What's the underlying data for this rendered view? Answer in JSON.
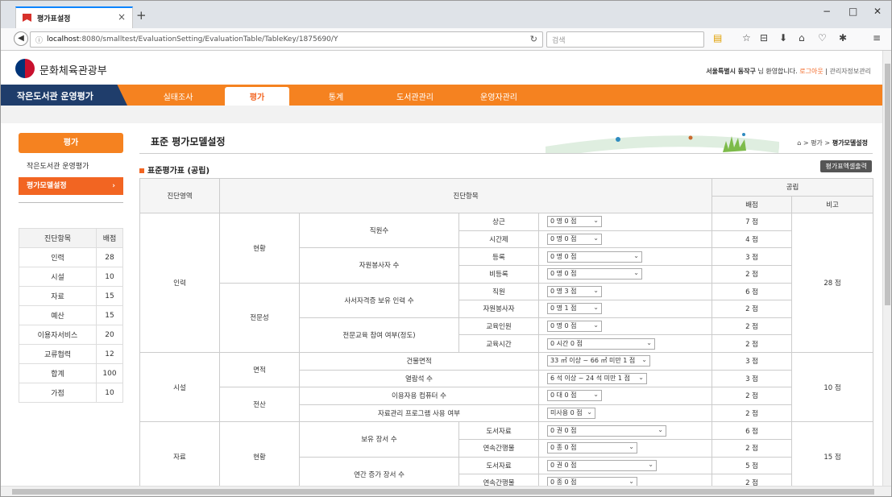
{
  "browser": {
    "tab_title": "평가표설정",
    "url_host": "localhost",
    "url_path": ":8080/smalltest/EvaluationSetting/EvaluationTable/TableKey/1875690/Y",
    "search_placeholder": "검색",
    "new_tab": "+",
    "close_tab": "×",
    "min": "−",
    "max": "□",
    "close": "✕"
  },
  "header": {
    "logo_text": "문화체육관광부",
    "user": "서울특별시 동작구",
    "welcome": " 님 환영합니다.",
    "logout": "로그아웃",
    "sep": " | ",
    "admin": "관리자정보관리"
  },
  "menubar": {
    "site_name": "작은도서관 운영평가",
    "items": [
      "실태조사",
      "평가",
      "통계",
      "도서관관리",
      "운영자관리"
    ],
    "active_index": 1
  },
  "sidebar": {
    "heading": "평가",
    "items": [
      "작은도서관 운영평가",
      "평가모델설정"
    ],
    "chevron": "›",
    "score_table": {
      "headers": [
        "진단항목",
        "배점"
      ],
      "rows": [
        [
          "인력",
          "28"
        ],
        [
          "시설",
          "10"
        ],
        [
          "자료",
          "15"
        ],
        [
          "예산",
          "15"
        ],
        [
          "이용자서비스",
          "20"
        ],
        [
          "교류협력",
          "12"
        ],
        [
          "합계",
          "100"
        ],
        [
          "가점",
          "10"
        ]
      ]
    }
  },
  "content": {
    "title": "표준 평가모델설정",
    "breadcrumb_home": "⌂",
    "breadcrumb_1": "> 평가 >",
    "breadcrumb_2": " 평가모델설정",
    "subtitle": "표준평가표 (공립)",
    "print_button": "평가표엑셀출력"
  },
  "table": {
    "h_area": "진단영역",
    "h_item": "진단항목",
    "h_public": "공립",
    "h_score": "배점",
    "h_note": "비고",
    "areas": [
      "인력",
      "시설",
      "자료"
    ],
    "groups": [
      "현황",
      "전문성",
      "면적",
      "전산",
      "현황"
    ],
    "criteria": [
      "직원수",
      "자원봉사자 수",
      "사서자격증 보유 인력 수",
      "전문교육 참여 여부(정도)",
      "건물면적",
      "열람석 수",
      "이용자용 컴퓨터 수",
      "자료관리 프로그램 사용 여부",
      "보유 장서 수",
      "연간 증가 장서 수"
    ],
    "subs": [
      "상근",
      "시간제",
      "등록",
      "비등록",
      "직원",
      "자원봉사자",
      "교육인원",
      "교육시간",
      "도서자료",
      "연속간행물",
      "도서자료",
      "연속간행물"
    ],
    "selects": [
      "0 명 0 점",
      "0 명 0 점",
      "0 명 0 점",
      "0 명 0 점",
      "0 명 3 점",
      "0 명 1 점",
      "0 명 0 점",
      "0 시간 0 점",
      "33 ㎡ 이상 ~ 66 ㎡ 미만 1 점",
      "6 석 이상 ~ 24 석 미만 1 점",
      "0 대 0 점",
      "미사용 0 점",
      "0 권 0 점",
      "0 종 0 점",
      "0 권 0 점",
      "0 종 0 점"
    ],
    "scores": [
      "7 점",
      "4 점",
      "3 점",
      "2 점",
      "6 점",
      "2 점",
      "2 점",
      "2 점",
      "3 점",
      "3 점",
      "2 점",
      "2 점",
      "6 점",
      "2 점",
      "5 점",
      "2 점"
    ],
    "notes": [
      "28 점",
      "10 점",
      "15 점"
    ]
  }
}
